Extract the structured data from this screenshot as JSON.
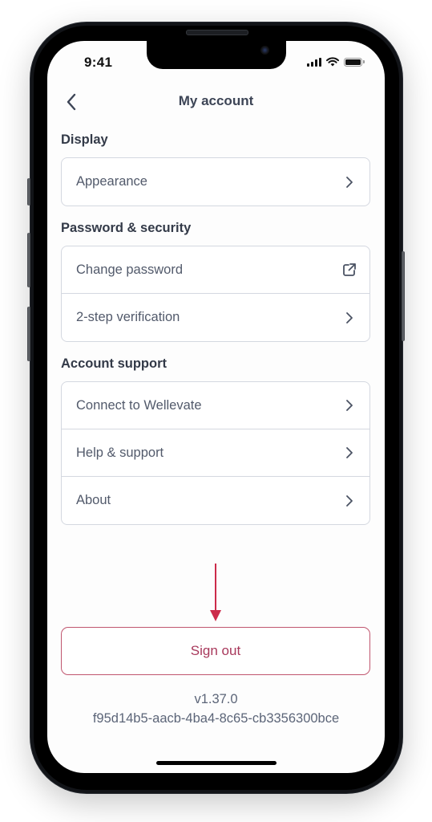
{
  "status_bar": {
    "time": "9:41",
    "signal_icon": "cellular-signal-icon",
    "wifi_icon": "wifi-icon",
    "battery_icon": "battery-icon"
  },
  "header": {
    "back_icon": "chevron-left-icon",
    "title": "My account"
  },
  "sections": [
    {
      "title": "Display",
      "items": [
        {
          "label": "Appearance",
          "icon": "chevron-right-icon"
        }
      ]
    },
    {
      "title": "Password & security",
      "items": [
        {
          "label": "Change password",
          "icon": "external-link-icon"
        },
        {
          "label": "2-step verification",
          "icon": "chevron-right-icon"
        }
      ]
    },
    {
      "title": "Account support",
      "items": [
        {
          "label": "Connect to Wellevate",
          "icon": "chevron-right-icon"
        },
        {
          "label": "Help & support",
          "icon": "chevron-right-icon"
        },
        {
          "label": "About",
          "icon": "chevron-right-icon"
        }
      ]
    }
  ],
  "annotation": {
    "icon": "arrow-down-icon",
    "color": "#cc2b4a"
  },
  "sign_out": {
    "label": "Sign out",
    "color": "#a8385b"
  },
  "footer": {
    "version": "v1.37.0",
    "build_id": "f95d14b5-aacb-4ba4-8c65-cb3356300bce"
  }
}
